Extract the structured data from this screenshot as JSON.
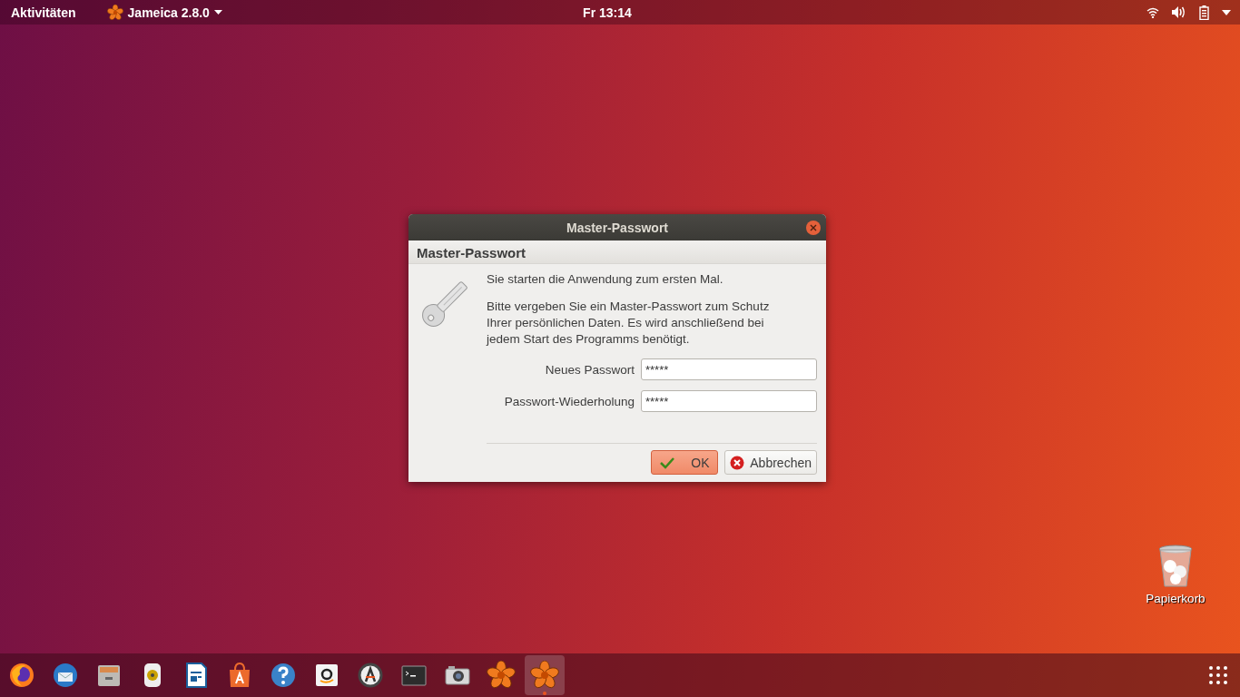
{
  "top_bar": {
    "activities": "Aktivitäten",
    "app_menu": "Jameica 2.8.0",
    "clock": "Fr 13:14"
  },
  "dialog": {
    "title": "Master-Passwort",
    "header": "Master-Passwort",
    "intro": "Sie starten die Anwendung zum ersten Mal.",
    "message": "Bitte vergeben Sie ein Master-Passwort zum Schutz Ihrer persönlichen Daten. Es wird anschließend bei jedem Start des Programms benötigt.",
    "fields": [
      {
        "label": "Neues Passwort",
        "value": "*****"
      },
      {
        "label": "Passwort-Wiederholung",
        "value": "*****"
      }
    ],
    "buttons": [
      {
        "kind": "ok",
        "label": "OK",
        "default": true
      },
      {
        "kind": "cancel",
        "label": "Abbrechen",
        "default": false
      }
    ]
  },
  "desktop_icons": [
    {
      "label": "Papierkorb"
    }
  ],
  "dock": {
    "items": [
      {
        "kind": "browser",
        "selected": false
      },
      {
        "kind": "mail",
        "selected": false
      },
      {
        "kind": "files",
        "selected": false
      },
      {
        "kind": "music",
        "selected": false
      },
      {
        "kind": "writer",
        "selected": false
      },
      {
        "kind": "software",
        "selected": false
      },
      {
        "kind": "help",
        "selected": false
      },
      {
        "kind": "shop",
        "selected": false
      },
      {
        "kind": "updater",
        "selected": false
      },
      {
        "kind": "terminal",
        "selected": false
      },
      {
        "kind": "camera",
        "selected": false
      },
      {
        "kind": "jameica",
        "selected": false
      },
      {
        "kind": "jameica",
        "selected": true
      }
    ]
  }
}
